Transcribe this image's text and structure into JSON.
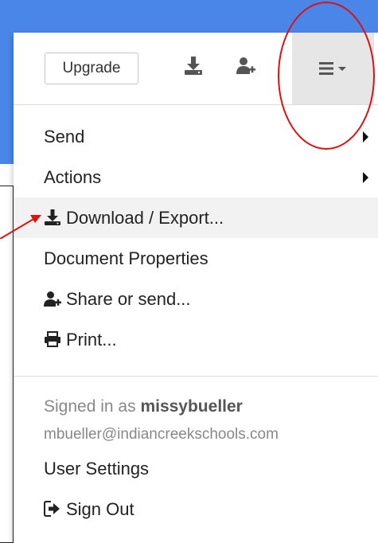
{
  "toolbar": {
    "upgrade_label": "Upgrade",
    "icons": [
      "download-icon",
      "add-user-icon",
      "hamburger-menu-icon",
      "caret-down-icon"
    ]
  },
  "menu": {
    "send": "Send",
    "actions": "Actions",
    "download": "Download / Export...",
    "document_properties": "Document Properties",
    "share": "Share or send...",
    "print": "Print...",
    "signed_in_prefix": "Signed in as",
    "username": "missybueller",
    "email": "mbueller@indiancreekschools.com",
    "user_settings": "User Settings",
    "sign_out": "Sign Out"
  },
  "colors": {
    "background_blue": "#4a86e8",
    "annotation_red": "#e01010",
    "menu_button_bg": "#e6e6e6",
    "hover_row_bg": "#f2f2f2"
  }
}
